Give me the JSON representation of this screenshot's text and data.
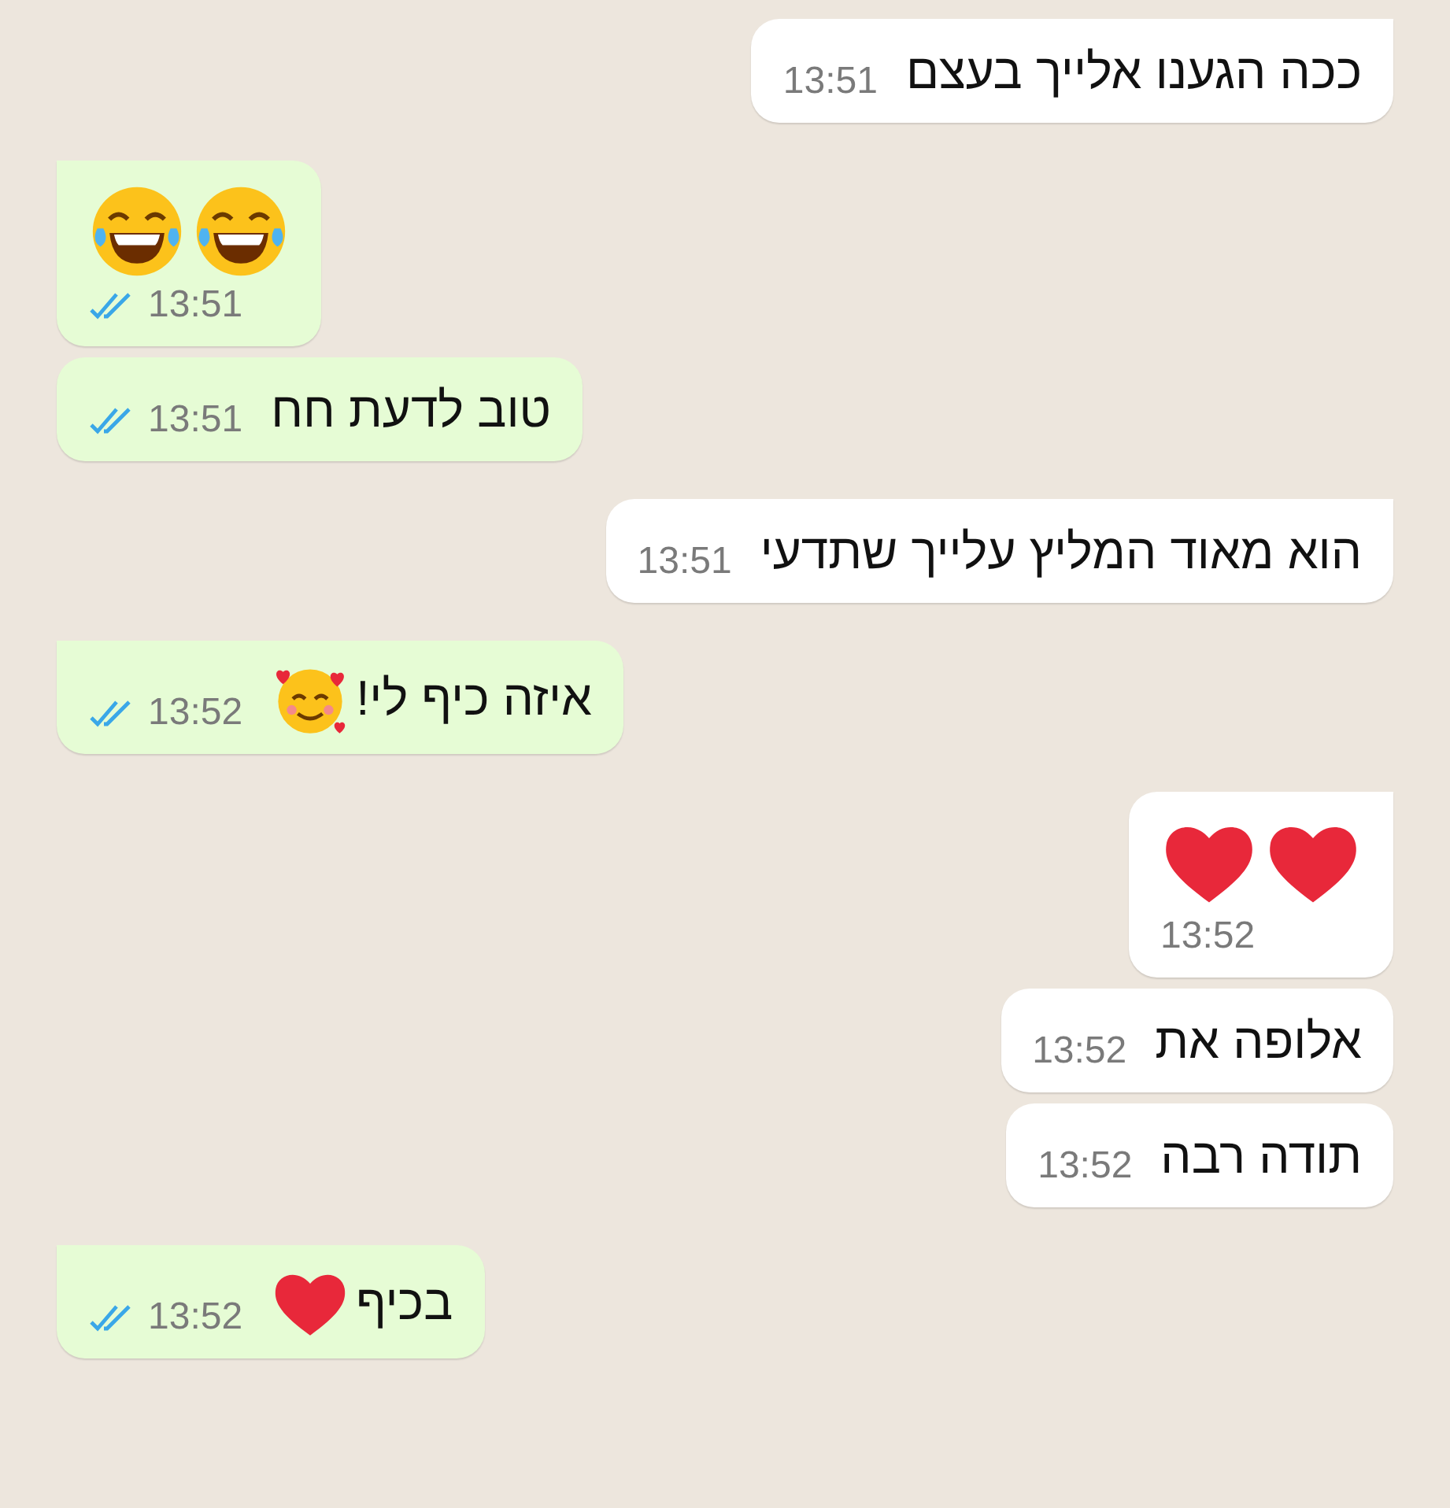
{
  "messages": [
    {
      "kind": "received",
      "tail": true,
      "text": "ככה הגענו אלייך בעצם",
      "time": "13:51"
    },
    {
      "kind": "sent",
      "tail": true,
      "emojis": [
        {
          "kind": "tears-of-joy"
        },
        {
          "kind": "tears-of-joy"
        }
      ],
      "time": "13:51",
      "read": true
    },
    {
      "kind": "sent",
      "tail": false,
      "text": "טוב לדעת חח",
      "time": "13:51",
      "read": true
    },
    {
      "kind": "received",
      "tail": true,
      "text": "הוא מאוד המליץ עלייך שתדעי",
      "time": "13:51"
    },
    {
      "kind": "sent",
      "tail": true,
      "text": "איזה כיף לי!",
      "emojis": [
        {
          "kind": "hearts-face"
        }
      ],
      "time": "13:52",
      "read": true
    },
    {
      "kind": "received",
      "tail": true,
      "emojis": [
        {
          "kind": "heart"
        },
        {
          "kind": "heart"
        }
      ],
      "time": "13:52"
    },
    {
      "kind": "received",
      "tail": false,
      "text": "אלופה את",
      "time": "13:52"
    },
    {
      "kind": "received",
      "tail": false,
      "text": "תודה רבה",
      "time": "13:52"
    },
    {
      "kind": "sent",
      "tail": true,
      "text": "בכיף",
      "emojis": [
        {
          "kind": "heart"
        }
      ],
      "time": "13:52",
      "read": true
    }
  ]
}
